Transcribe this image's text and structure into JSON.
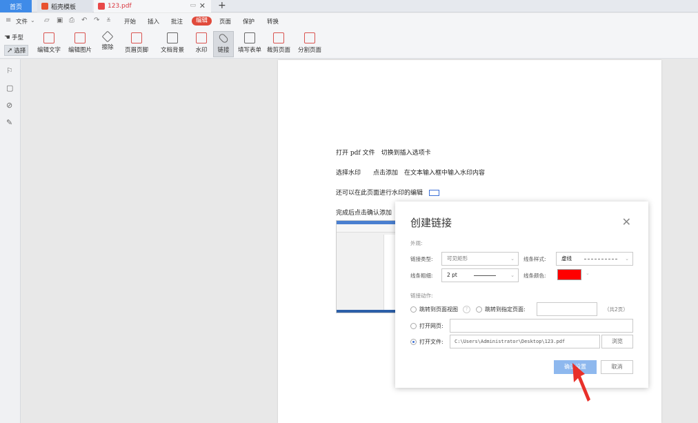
{
  "tabs": {
    "home": "首页",
    "templates": "稻壳模板",
    "pdf": "123.pdf",
    "add": "+"
  },
  "menu": {
    "file": "文件",
    "start": "开始",
    "insert": "插入",
    "comment": "批注",
    "edit": "编辑",
    "page": "页面",
    "protect": "保护",
    "convert": "转换"
  },
  "ribbon": {
    "hand": "手型",
    "select": "选择",
    "tools": [
      "编辑文字",
      "编辑图片",
      "擦除",
      "页眉页脚",
      "文档背景",
      "水印",
      "链接",
      "填写表单",
      "裁剪页面",
      "分割页面"
    ]
  },
  "document": {
    "lines": [
      "打开 pdf 文件　切换到插入选项卡",
      "选择水印　　点击添加　在文本输入框中输入水印内容",
      "还可以在此页面进行水印的编辑",
      "完成后点击确认添加"
    ]
  },
  "dialog": {
    "title": "创建链接",
    "appearance_label": "外观:",
    "link_type_label": "链接类型:",
    "link_type_value": "可见矩形",
    "line_style_label": "线条样式:",
    "line_style_value": "虚线",
    "line_width_label": "线条粗细:",
    "line_width_value": "2 pt",
    "line_color_label": "线条颜色:",
    "line_color": "#FF0000",
    "action_label": "链接动作:",
    "opt_goto_view": "跳转到页面视图",
    "opt_goto_page": "跳转到指定页面:",
    "page_count": "（共2页）",
    "opt_open_web": "打开网页:",
    "opt_open_file": "打开文件:",
    "file_path": "C:\\Users\\Administrator\\Desktop\\123.pdf",
    "browse": "浏览",
    "confirm": "确认设置",
    "cancel": "取消"
  }
}
